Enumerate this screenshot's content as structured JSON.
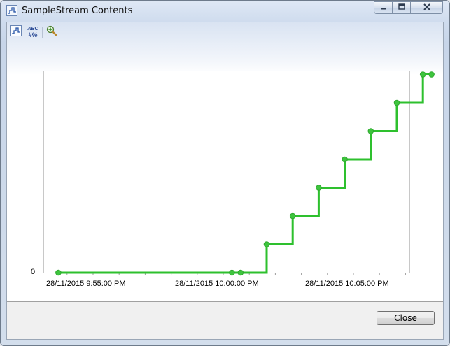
{
  "window": {
    "title": "SampleStream Contents"
  },
  "toolbar": {
    "tools": [
      {
        "icon": "step-chart-icon"
      },
      {
        "icon": "abc-format-icon",
        "text_top": "ABC",
        "text_bottom": "#%"
      },
      {
        "icon": "zoom-in-icon"
      }
    ]
  },
  "chart_data": {
    "type": "line",
    "step": true,
    "title": "",
    "xlabel": "",
    "ylabel": "",
    "y_tick_labels": [
      "0"
    ],
    "x_tick_labels": [
      "28/11/2015 9:55:00 PM",
      "28/11/2015 10:00:00 PM",
      "28/11/2015 10:05:00 PM"
    ],
    "series": [
      {
        "color": "#2ec02e",
        "x": [
          "9:53:40 PM",
          "10:00:20 PM",
          "10:00:40 PM",
          "10:01:40 PM",
          "10:02:40 PM",
          "10:03:40 PM",
          "10:04:40 PM",
          "10:05:40 PM",
          "10:06:40 PM",
          "10:07:40 PM",
          "10:08:00 PM"
        ],
        "y": [
          0,
          0,
          0,
          1,
          2,
          3,
          4,
          5,
          6,
          7,
          7
        ]
      }
    ],
    "grid": false
  },
  "footer": {
    "close_label": "Close"
  },
  "colors": {
    "series": "#2ec02e",
    "marker": "#2ea82e"
  }
}
